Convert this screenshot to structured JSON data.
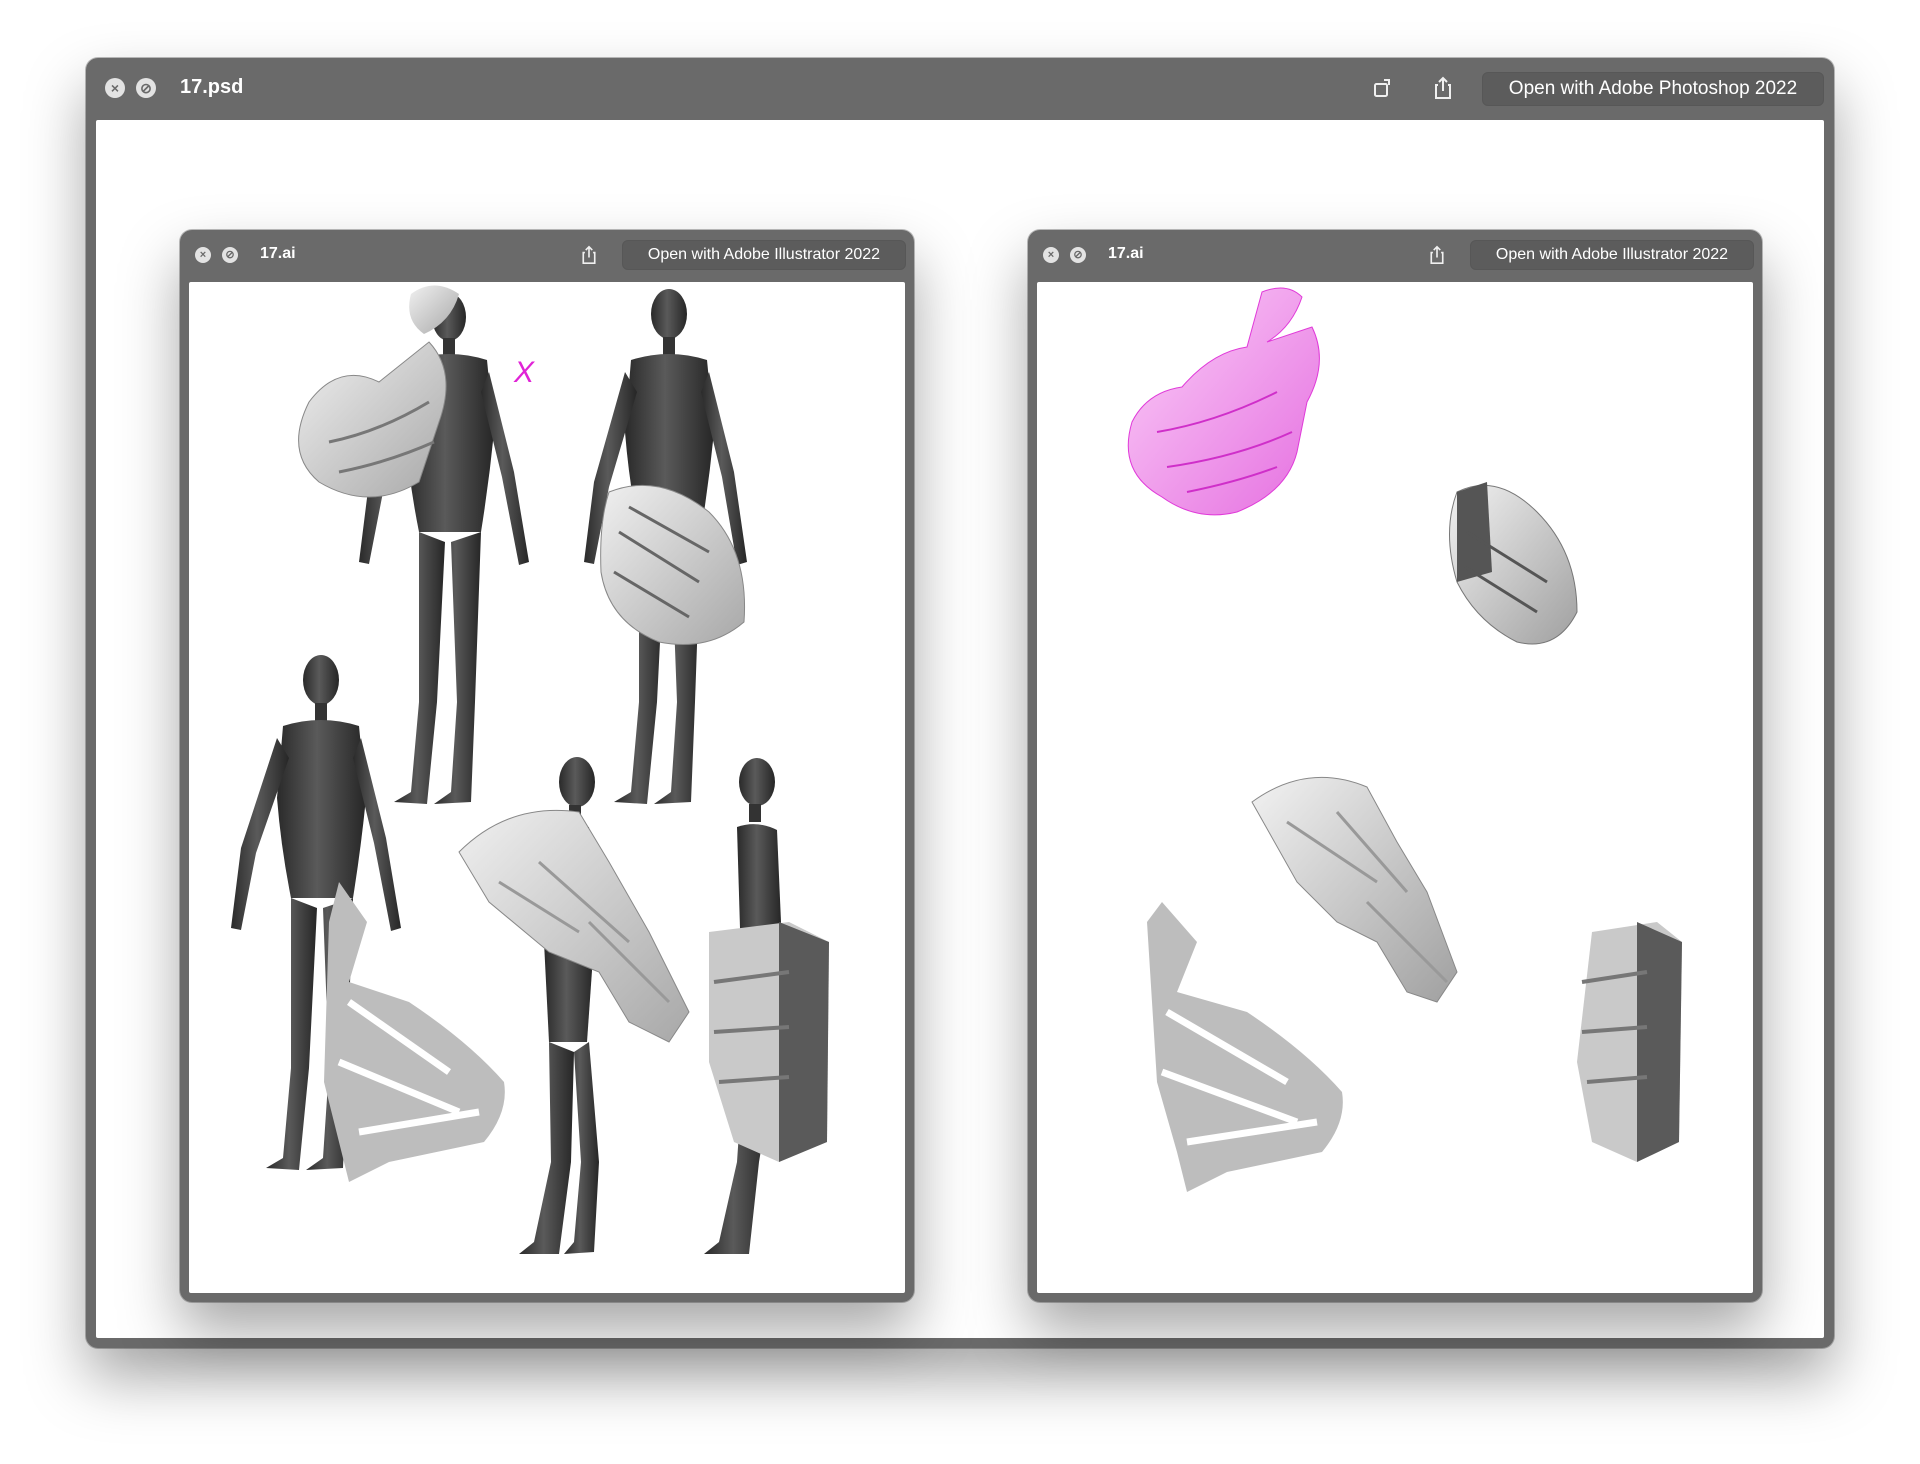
{
  "outer": {
    "title": "17.psd",
    "open_button": "Open with Adobe Photoshop 2022"
  },
  "left_preview": {
    "title": "17.ai",
    "open_button": "Open with Adobe Illustrator 2022",
    "annotation_mark": "X"
  },
  "right_preview": {
    "title": "17.ai",
    "open_button": "Open with Adobe Illustrator 2022"
  },
  "colors": {
    "titlebar": "#6a6a6a",
    "annotation": "#e023d6",
    "highlight_piece": "#f3a6ee",
    "mannequin": "#3a3a3a",
    "garment": "#cfcfcf"
  },
  "icons": [
    "close-icon",
    "minimize-icon",
    "rotate-icon",
    "share-icon"
  ]
}
